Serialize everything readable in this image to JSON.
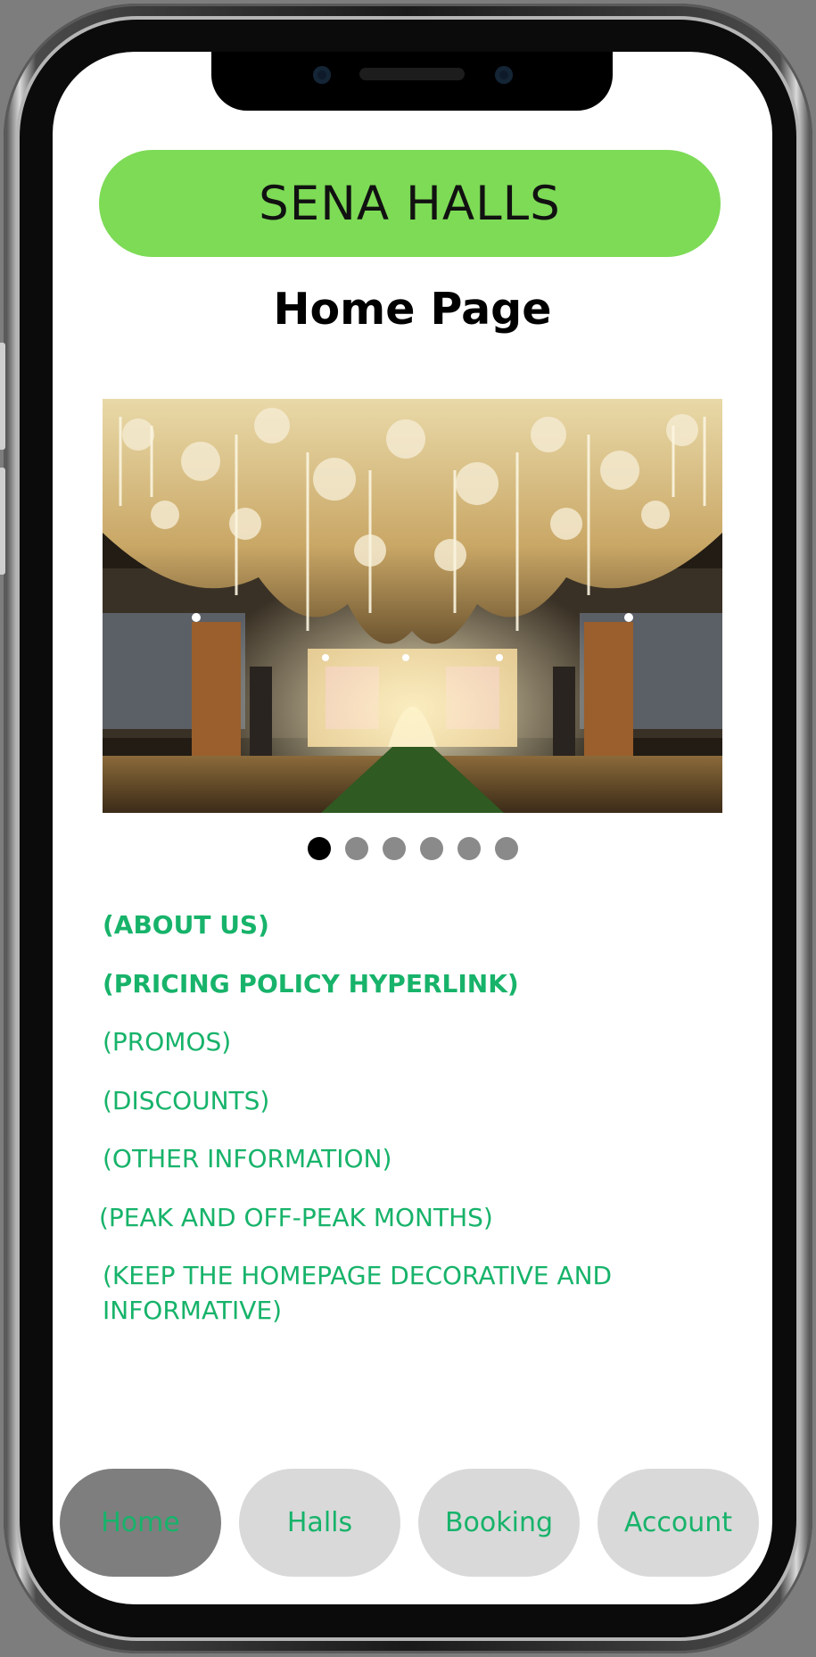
{
  "header": {
    "app_title": "SENA HALLS",
    "page_title": "Home Page"
  },
  "carousel": {
    "image": "banquet-hall-floral-ceiling-photo",
    "slide_count": 6,
    "active_index": 0
  },
  "links": [
    {
      "label": "(ABOUT US)",
      "bold": true
    },
    {
      "label": "(PRICING POLICY HYPERLINK)",
      "bold": true
    },
    {
      "label": "(PROMOS)",
      "bold": false
    },
    {
      "label": "(DISCOUNTS)",
      "bold": false
    },
    {
      "label": "(OTHER INFORMATION)",
      "bold": false
    },
    {
      "label": "(PEAK AND OFF-PEAK MONTHS)",
      "bold": false
    },
    {
      "label": "(KEEP THE HOMEPAGE DECORATIVE AND INFORMATIVE)",
      "bold": false
    }
  ],
  "nav": {
    "items": [
      {
        "label": "Home",
        "active": true
      },
      {
        "label": "Halls",
        "active": false
      },
      {
        "label": "Booking",
        "active": false
      },
      {
        "label": "Account",
        "active": false
      }
    ]
  },
  "colors": {
    "title_pill": "#7ddb56",
    "link_text": "#17b36a",
    "nav_inactive": "#d9d9d9",
    "nav_active": "#7e7e7e",
    "dot_active": "#000000",
    "dot_inactive": "#8a8a8a"
  }
}
